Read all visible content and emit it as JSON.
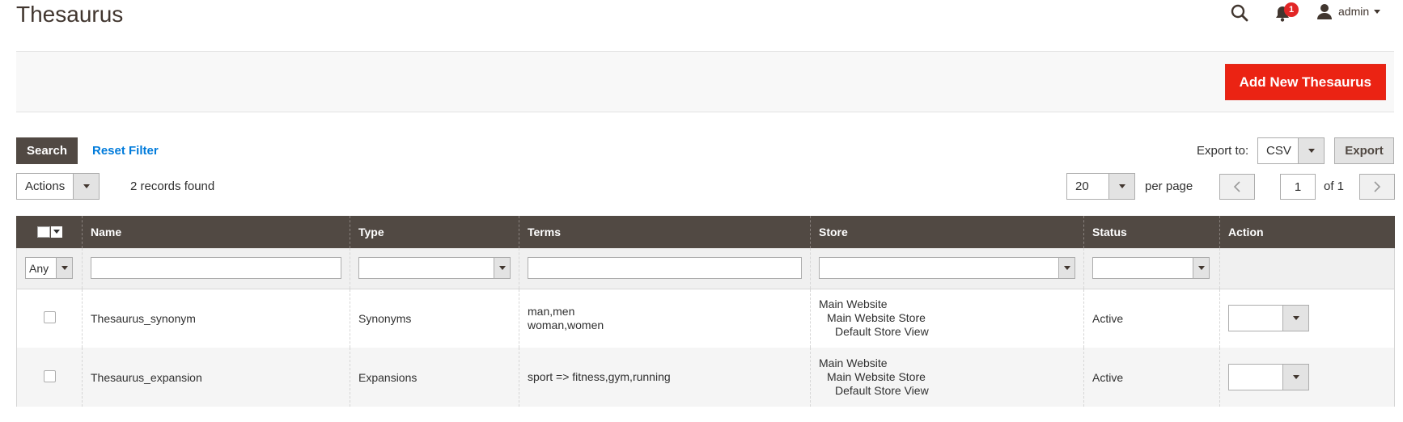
{
  "page": {
    "title": "Thesaurus"
  },
  "header": {
    "notification_count": "1",
    "user_name": "admin"
  },
  "page_actions": {
    "add_new_label": "Add New Thesaurus"
  },
  "grid_controls": {
    "search_label": "Search",
    "reset_filter_label": "Reset Filter",
    "export_to_label": "Export to:",
    "export_format": "CSV",
    "export_label": "Export",
    "mass_actions_label": "Actions",
    "records_found": "2 records found",
    "per_page_value": "20",
    "per_page_label": "per page",
    "current_page": "1",
    "of_pages": "of 1"
  },
  "table": {
    "columns": [
      "Name",
      "Type",
      "Terms",
      "Store",
      "Status",
      "Action"
    ],
    "filters": {
      "mass_select": "Any"
    },
    "rows": [
      {
        "name": "Thesaurus_synonym",
        "type": "Synonyms",
        "terms": [
          "man,men",
          "woman,women"
        ],
        "store": [
          "Main Website",
          "Main Website Store",
          "Default Store View"
        ],
        "status": "Active"
      },
      {
        "name": "Thesaurus_expansion",
        "type": "Expansions",
        "terms": [
          "sport => fitness,gym,running"
        ],
        "store": [
          "Main Website",
          "Main Website Store",
          "Default Store View"
        ],
        "status": "Active"
      }
    ]
  },
  "colors": {
    "header_bg": "#514943",
    "primary_button": "#eb2313",
    "link": "#007bdb",
    "badge": "#e22626"
  },
  "icons": [
    "search-icon",
    "bell-icon",
    "user-icon",
    "chevron-left-icon",
    "chevron-right-icon"
  ]
}
